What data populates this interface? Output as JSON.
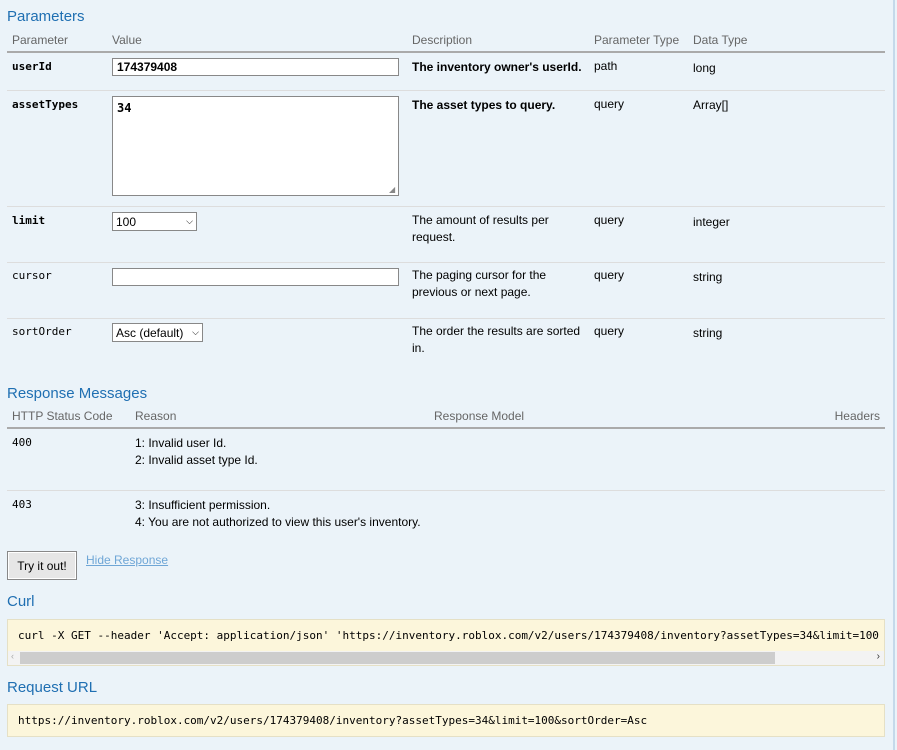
{
  "parameters": {
    "title": "Parameters",
    "headers": [
      "Parameter",
      "Value",
      "Description",
      "Parameter Type",
      "Data Type"
    ],
    "rows": [
      {
        "name": "userId",
        "value": "174379408",
        "description": "The inventory owner's userId.",
        "param_type": "path",
        "data_type": "long"
      },
      {
        "name": "assetTypes",
        "value": "34",
        "description": "The asset types to query.",
        "param_type": "query",
        "data_type": "Array[]"
      },
      {
        "name": "limit",
        "value": "100",
        "description": "The amount of results per request.",
        "param_type": "query",
        "data_type": "integer"
      },
      {
        "name": "cursor",
        "value": "",
        "description": "The paging cursor for the previous or next page.",
        "param_type": "query",
        "data_type": "string"
      },
      {
        "name": "sortOrder",
        "value": "Asc (default)",
        "description": "The order the results are sorted in.",
        "param_type": "query",
        "data_type": "string"
      }
    ]
  },
  "responses": {
    "title": "Response Messages",
    "headers": [
      "HTTP Status Code",
      "Reason",
      "Response Model",
      "Headers"
    ],
    "rows": [
      {
        "code": "400",
        "reasons": [
          "1: Invalid user Id.",
          "2: Invalid asset type Id."
        ]
      },
      {
        "code": "403",
        "reasons": [
          "3: Insufficient permission.",
          "4: You are not authorized to view this user's inventory."
        ]
      }
    ]
  },
  "actions": {
    "try_label": "Try it out!",
    "hide_label": "Hide Response"
  },
  "curl": {
    "title": "Curl",
    "command": "curl -X GET --header 'Accept: application/json' 'https://inventory.roblox.com/v2/users/174379408/inventory?assetTypes=34&limit=100"
  },
  "request_url": {
    "title": "Request URL",
    "url": "https://inventory.roblox.com/v2/users/174379408/inventory?assetTypes=34&limit=100&sortOrder=Asc"
  }
}
